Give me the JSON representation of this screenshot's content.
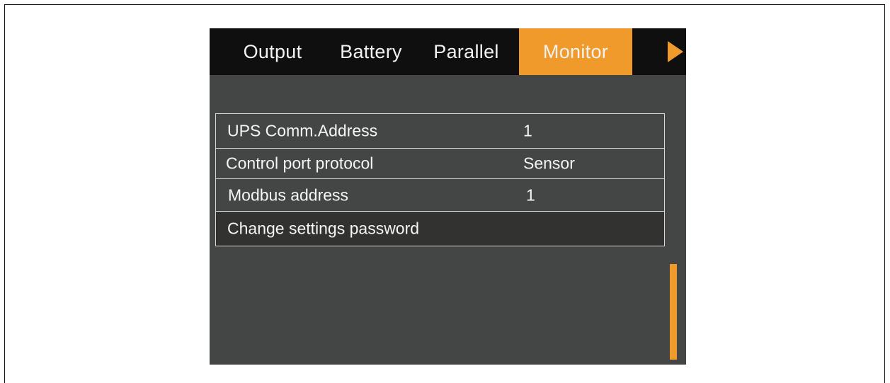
{
  "tabs": [
    {
      "label": "Output"
    },
    {
      "label": "Battery"
    },
    {
      "label": "Parallel"
    },
    {
      "label": "Monitor",
      "active": true
    }
  ],
  "next_icon": "triangle-right-icon",
  "settings": [
    {
      "label": "UPS Comm.Address",
      "value": "1"
    },
    {
      "label": "Control port protocol",
      "value": "Sensor"
    },
    {
      "label": "Modbus address",
      "value": "1"
    },
    {
      "label": "Change settings password",
      "value": ""
    }
  ],
  "colors": {
    "accent": "#f09a2c",
    "tabbar_bg": "#0f0f0f",
    "screen_bg": "#444645",
    "selected_row_bg": "#323331",
    "text": "#f5f5f5"
  }
}
